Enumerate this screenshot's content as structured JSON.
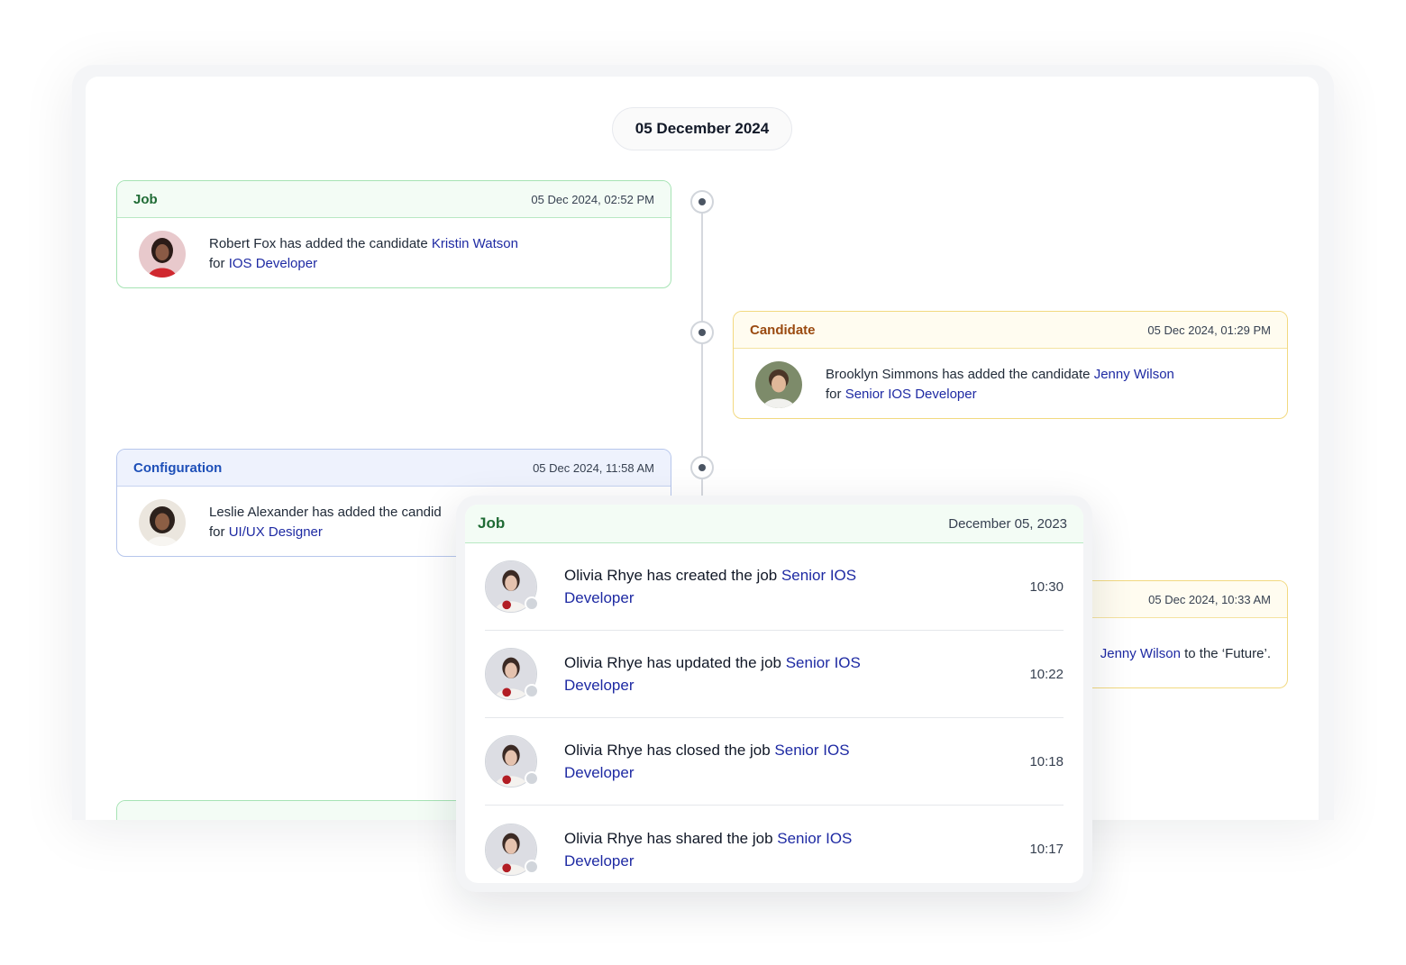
{
  "date_header": "05 December 2024",
  "timeline": [
    {
      "category": "Job",
      "timestamp": "05 Dec 2024, 02:52 PM",
      "actor": "Robert Fox",
      "action": " has added the candidate ",
      "target": "Kristin Watson",
      "for_label": "for ",
      "role": "IOS Developer"
    },
    {
      "category": "Candidate",
      "timestamp": "05 Dec 2024, 01:29 PM",
      "actor": "Brooklyn Simmons",
      "action": " has added the candidate ",
      "target": "Jenny Wilson",
      "for_label": "for ",
      "role": "Senior IOS Developer"
    },
    {
      "category": "Configuration",
      "timestamp": "05 Dec 2024, 11:58 AM",
      "actor": "Leslie Alexander",
      "action": " has added the candid",
      "for_label": "for ",
      "role": "UI/UX Designer"
    },
    {
      "timestamp": "05 Dec 2024, 10:33 AM",
      "target": "Jenny Wilson",
      "suffix": " to the ‘Future’."
    }
  ],
  "job_panel": {
    "category": "Job",
    "date": "December 05, 2023",
    "entries": [
      {
        "actor": "Olivia Rhye",
        "action": " has created the job ",
        "target": "Senior IOS",
        "target2": "Developer",
        "time": "10:30"
      },
      {
        "actor": "Olivia Rhye",
        "action": " has updated the job ",
        "target": "Senior IOS",
        "target2": "Developer",
        "time": "10:22"
      },
      {
        "actor": "Olivia Rhye",
        "action": " has closed the job ",
        "target": "Senior IOS",
        "target2": "Developer",
        "time": "10:18"
      },
      {
        "actor": "Olivia Rhye",
        "action": " has shared the job ",
        "target": "Senior IOS",
        "target2": "Developer",
        "time": "10:17"
      }
    ]
  },
  "colors": {
    "link": "#1e2aa3",
    "job_green": "#1f6b35",
    "candidate_orange": "#9a4a10",
    "configuration_blue": "#1d4fb8"
  }
}
